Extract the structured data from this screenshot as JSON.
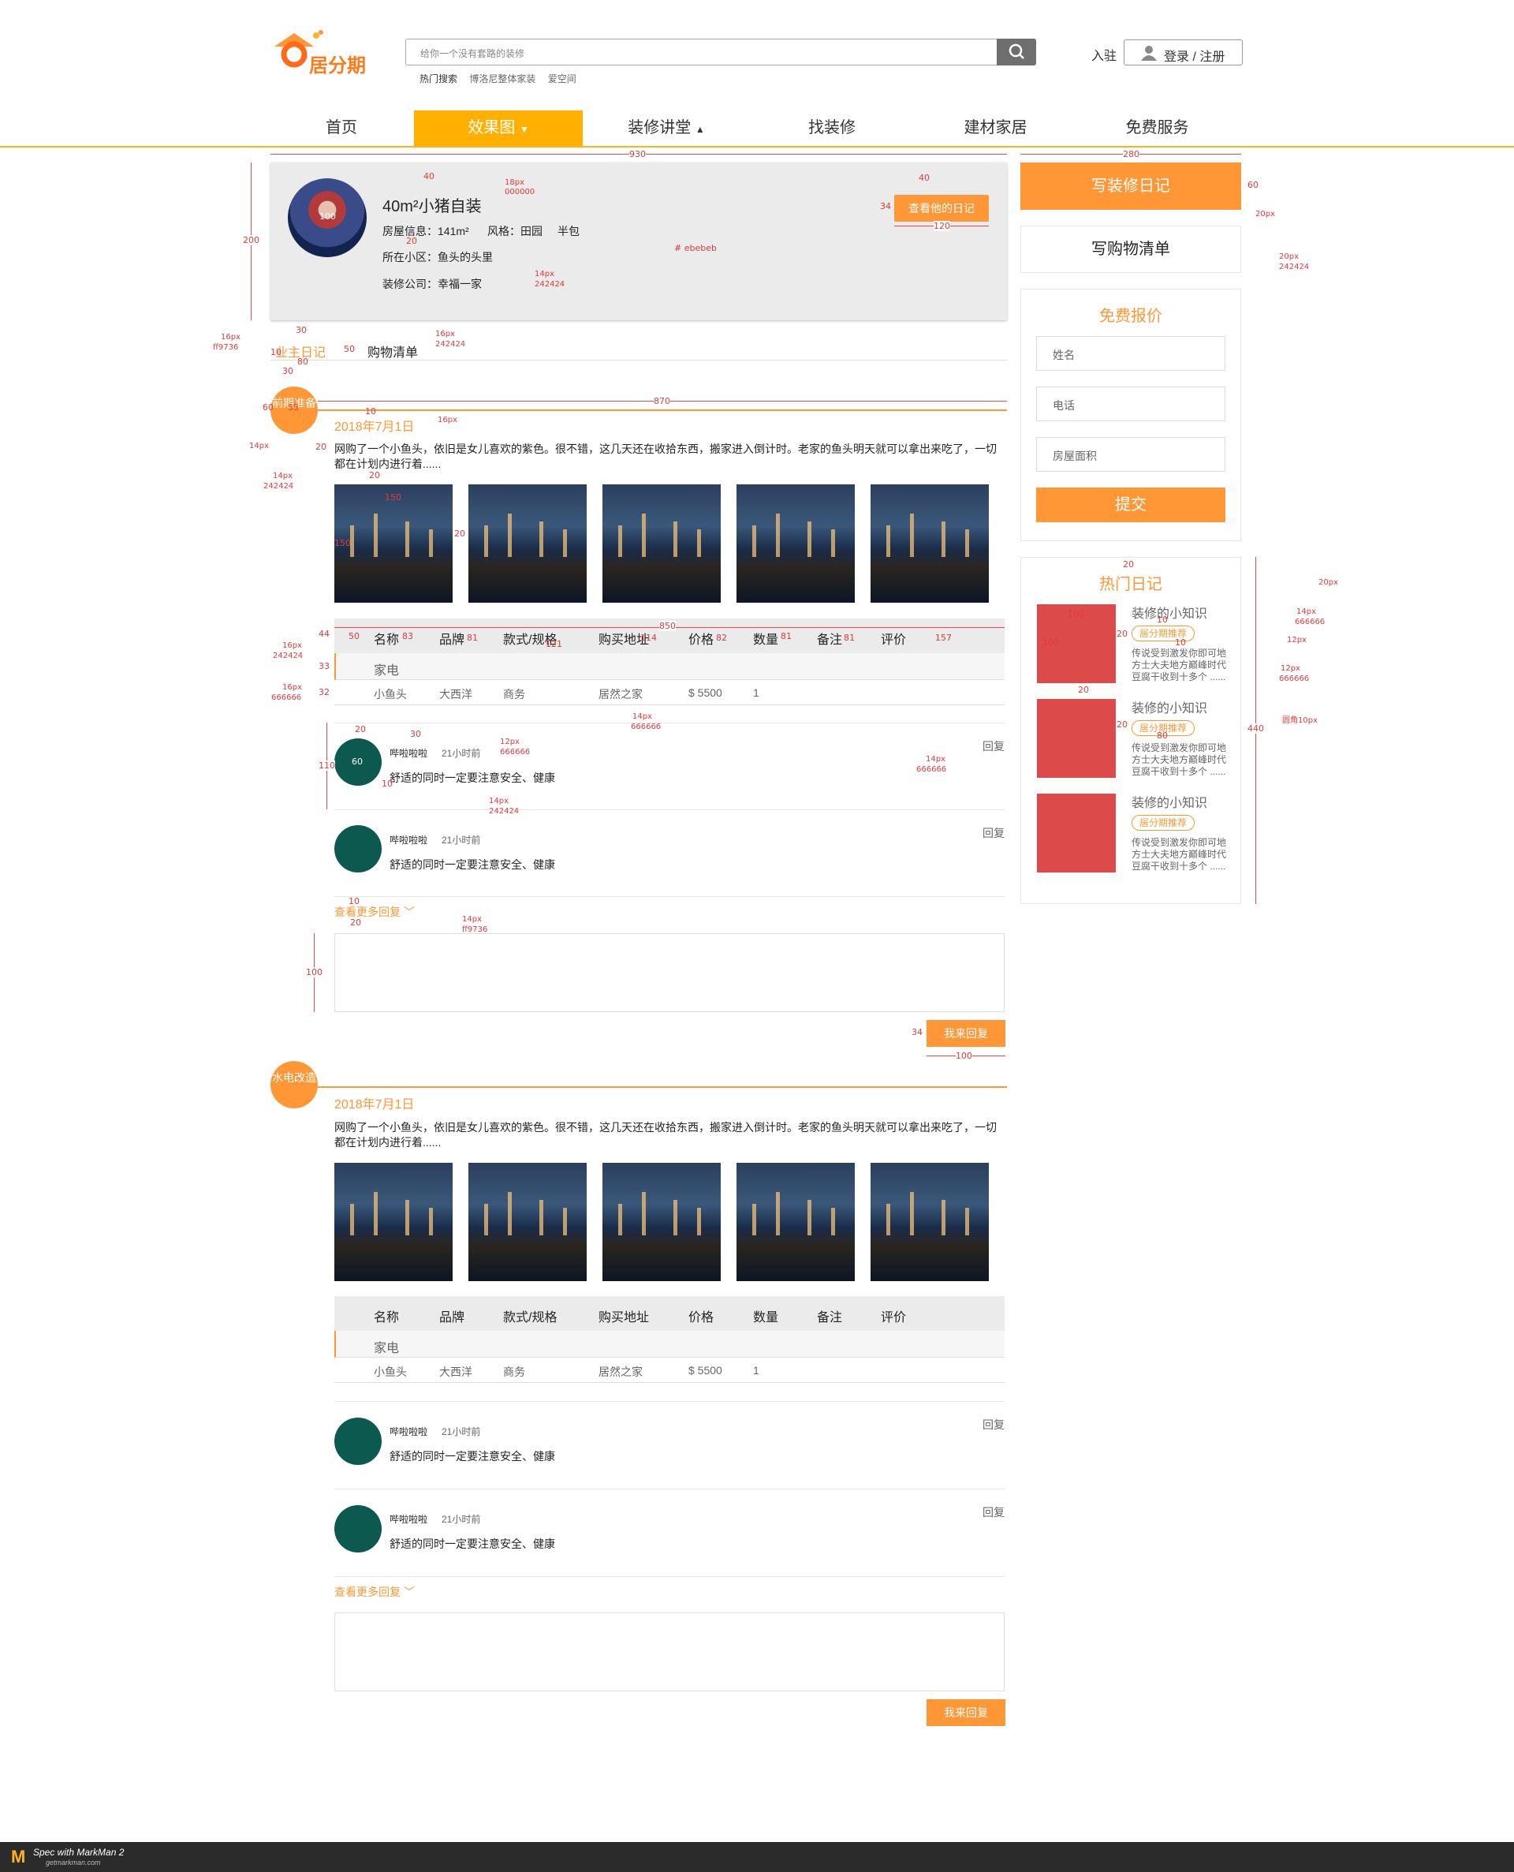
{
  "header": {
    "logo_text": "居分期",
    "search_placeholder": "给你一个没有套路的装修",
    "hot_label": "热门搜索",
    "hot_items": [
      "博洛尼整体家装",
      "爱空间"
    ],
    "settle": "入驻",
    "login": "登录 / 注册"
  },
  "nav": [
    "首页",
    "效果图",
    "装修讲堂",
    "找装修",
    "建材家居",
    "免费服务"
  ],
  "profile": {
    "title": "40m²小猪自装",
    "house_label": "房屋信息：141m²",
    "style_label": "风格：田园",
    "package": "半包",
    "community": "所在小区：鱼头的头里",
    "company": "装修公司：幸福一家",
    "view_btn": "查看他的日记"
  },
  "tabs": [
    "业主日记",
    "购物清单"
  ],
  "entries": [
    {
      "badge": "前期准备",
      "date": "2018年7月1日",
      "text": "网购了一个小鱼头，依旧是女儿喜欢的紫色。很不错，这几天还在收拾东西，搬家进入倒计时。老家的鱼头明天就可以拿出来吃了，一切都在计划内进行着......",
      "table_head": [
        "名称",
        "品牌",
        "款式/规格",
        "购买地址",
        "价格",
        "数量",
        "备注",
        "评价"
      ],
      "category": "家电",
      "row": [
        "小鱼头",
        "大西洋",
        "商务",
        "居然之家",
        "$ 5500",
        "1"
      ],
      "comments": [
        {
          "name": "哔啦啦啦",
          "time": "21小时前",
          "text": "舒适的同时一定要注意安全、健康",
          "reply": "回复"
        },
        {
          "name": "哔啦啦啦",
          "time": "21小时前",
          "text": "舒适的同时一定要注意安全、健康",
          "reply": "回复"
        }
      ],
      "more": "查看更多回复",
      "reply_btn": "我来回复"
    },
    {
      "badge": "水电改造",
      "date": "2018年7月1日",
      "text": "网购了一个小鱼头，依旧是女儿喜欢的紫色。很不错，这几天还在收拾东西，搬家进入倒计时。老家的鱼头明天就可以拿出来吃了，一切都在计划内进行着......",
      "table_head": [
        "名称",
        "品牌",
        "款式/规格",
        "购买地址",
        "价格",
        "数量",
        "备注",
        "评价"
      ],
      "category": "家电",
      "row": [
        "小鱼头",
        "大西洋",
        "商务",
        "居然之家",
        "$ 5500",
        "1"
      ],
      "comments": [
        {
          "name": "哔啦啦啦",
          "time": "21小时前",
          "text": "舒适的同时一定要注意安全、健康",
          "reply": "回复"
        },
        {
          "name": "哔啦啦啦",
          "time": "21小时前",
          "text": "舒适的同时一定要注意安全、健康",
          "reply": "回复"
        }
      ],
      "more": "查看更多回复",
      "reply_btn": "我来回复"
    }
  ],
  "sidebar": {
    "write_btn": "写装修日记",
    "shop_btn": "写购物清单",
    "quote_title": "免费报价",
    "fields": [
      "姓名",
      "电话",
      "房屋面积"
    ],
    "submit": "提交",
    "hot_title": "热门日记",
    "hot_items": [
      {
        "title": "装修的小知识",
        "badge": "居分期推荐",
        "text": "传说受到激发你即可地方士大夫地方巅峰时代豆腐干收到十多个 ......"
      },
      {
        "title": "装修的小知识",
        "badge": "居分期推荐",
        "text": "传说受到激发你即可地方士大夫地方巅峰时代豆腐干收到十多个 ......"
      },
      {
        "title": "装修的小知识",
        "badge": "居分期推荐",
        "text": "传说受到激发你即可地方士大夫地方巅峰时代豆腐干收到十多个 ......"
      }
    ]
  },
  "annotations": {
    "w930": "930",
    "w280": "280",
    "h200": "200",
    "h40": "40",
    "px18": "18px",
    "c000000": "000000",
    "h40b": "40",
    "h34": "34",
    "w120": "120",
    "h60": "60",
    "px20a": "20px",
    "px20b": "20px",
    "c242424a": "242424",
    "ebebeb": "# ebebeb",
    "px14a": "14px",
    "c242424b": "242424",
    "w20a": "20",
    "n100": "100",
    "px16a": "16px",
    "cff9736a": "ff9736",
    "n30": "30",
    "n10": "10",
    "n80": "80",
    "n50": "50",
    "px16b": "16px",
    "c242424c": "242424",
    "n30b": "30",
    "n60": "60",
    "n55": "55",
    "w870": "870",
    "n10b": "10",
    "px16c": "16px",
    "px14b": "14px",
    "n20c": "20",
    "px14c": "14px",
    "c242424d": "242424",
    "n20d": "20",
    "n150a": "150",
    "n150b": "150",
    "n20e": "20",
    "n44": "44",
    "n50b": "50",
    "n83": "83",
    "n81a": "81",
    "n121": "121",
    "n114": "114",
    "n82": "82",
    "n81b": "81",
    "n81c": "81",
    "n157": "157",
    "w850": "850",
    "px16d": "16px",
    "c242424e": "242424",
    "n33": "33",
    "px16e": "16px",
    "c666666a": "666666",
    "n32": "32",
    "px14d": "14px",
    "c666666b": "666666",
    "n20f": "20",
    "n30c": "30",
    "px12a": "12px",
    "c666666c": "666666",
    "n110": "110",
    "n60b": "60",
    "n10c": "10",
    "px14e": "14px",
    "c666666d": "666666",
    "px14f": "14px",
    "c242424f": "242424",
    "n10d": "10",
    "n20g": "20",
    "px14g": "14px",
    "cff9736b": "ff9736",
    "n100b": "100",
    "n34b": "34",
    "n100c": "100",
    "n20h": "20",
    "px20c": "20px",
    "n100d": "100",
    "n10e": "10",
    "n100e": "100",
    "n20i": "20",
    "px14h": "14px",
    "c666666e": "666666",
    "n10f": "10",
    "px12b": "12px",
    "n20j": "20",
    "px12c": "12px",
    "c666666f": "666666",
    "n20k": "20",
    "n80b": "80",
    "r10": "圆角10px",
    "n440": "440"
  },
  "footer": "Spec with MarkMan 2",
  "footer_sub": "getmarkman.com"
}
